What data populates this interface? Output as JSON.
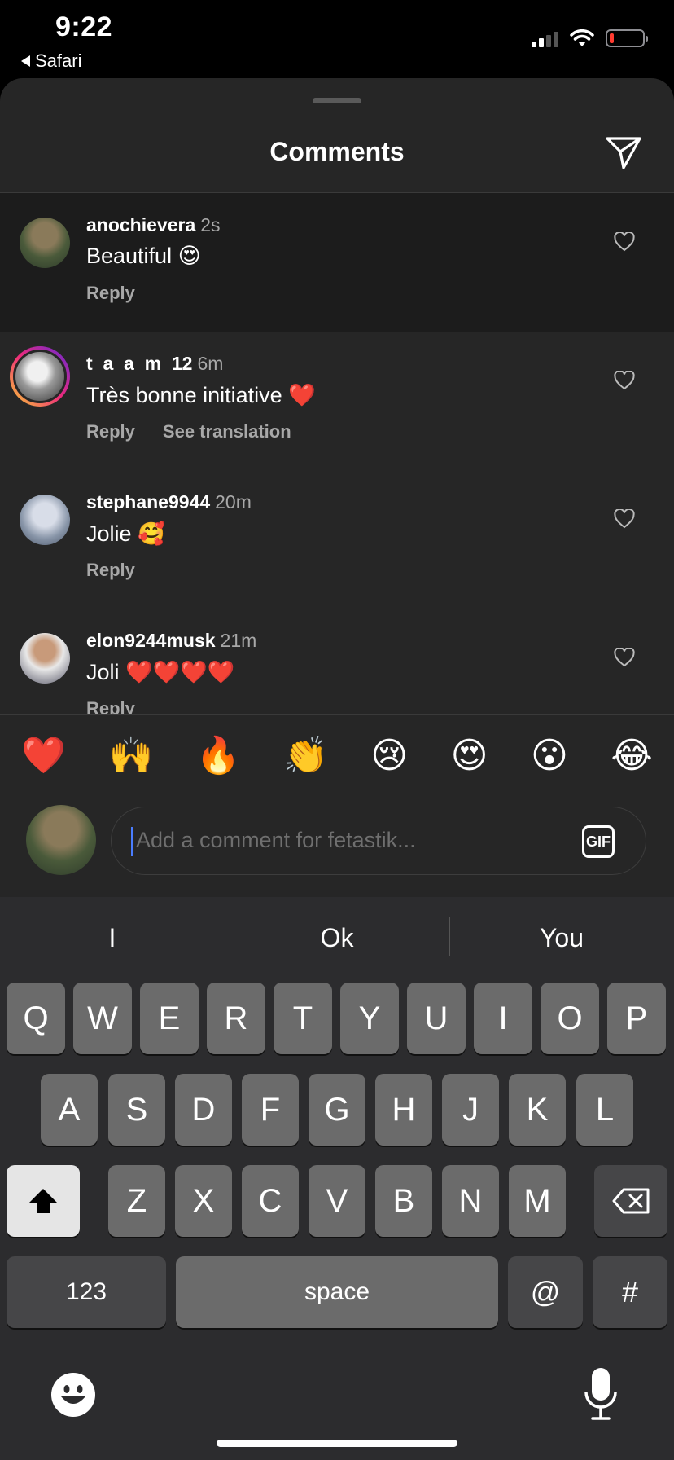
{
  "status": {
    "time": "9:22",
    "back_label": "Safari"
  },
  "sheet": {
    "title": "Comments"
  },
  "comments": [
    {
      "username": "anochievera",
      "time": "2s",
      "text": "Beautiful 😍",
      "reply": "Reply"
    },
    {
      "username": "t_a_a_m_12",
      "time": "6m",
      "text": "Très bonne initiative ❤️",
      "reply": "Reply",
      "translation": "See translation"
    },
    {
      "username": "stephane9944",
      "time": "20m",
      "text": "Jolie 🥰",
      "reply": "Reply"
    },
    {
      "username": "elon9244musk",
      "time": "21m",
      "text": "Joli ❤️❤️❤️❤️",
      "reply": "Reply"
    }
  ],
  "reactions": [
    "❤️",
    "🙌",
    "🔥",
    "👏",
    "😢",
    "😍",
    "😮",
    "😂"
  ],
  "composer": {
    "placeholder": "Add a comment for fetastik...",
    "gif_label": "GIF"
  },
  "keyboard": {
    "suggestions": [
      "I",
      "Ok",
      "You"
    ],
    "row1": [
      "Q",
      "W",
      "E",
      "R",
      "T",
      "Y",
      "U",
      "I",
      "O",
      "P"
    ],
    "row2": [
      "A",
      "S",
      "D",
      "F",
      "G",
      "H",
      "J",
      "K",
      "L"
    ],
    "row3": [
      "Z",
      "X",
      "C",
      "V",
      "B",
      "N",
      "M"
    ],
    "numbers_label": "123",
    "space_label": "space",
    "at_label": "@",
    "hash_label": "#"
  },
  "colors": {
    "background": "#262626",
    "muted": "#a8a8a8",
    "battery_low": "#ff3b30",
    "caret": "#4a7dff"
  }
}
